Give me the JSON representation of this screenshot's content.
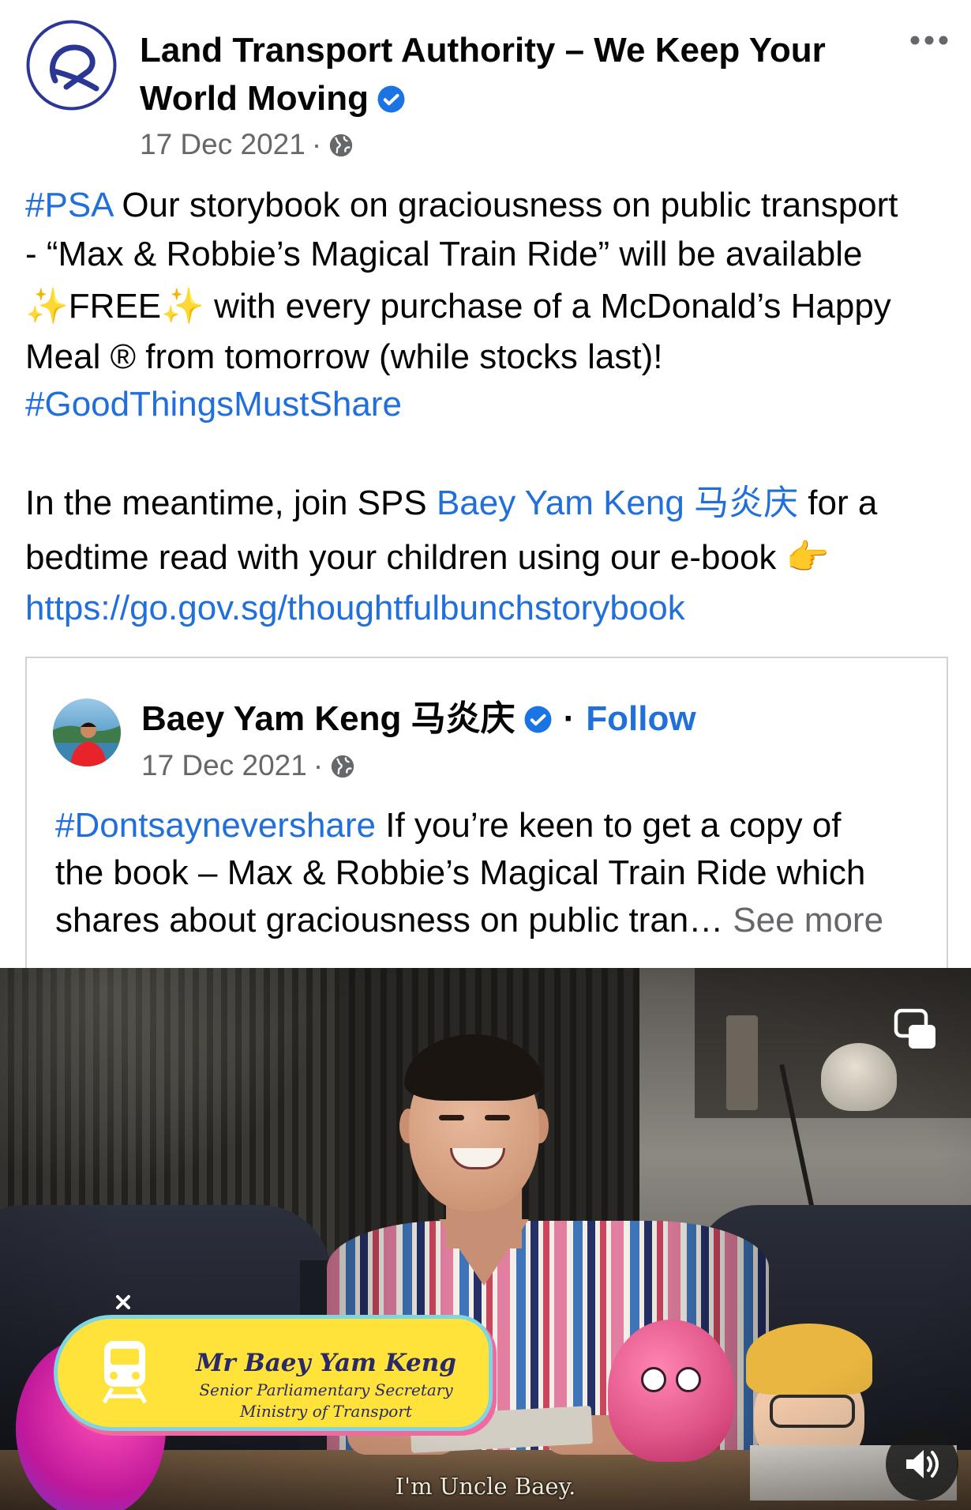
{
  "colors": {
    "text": "#050505",
    "secondary": "#65676B",
    "link": "#216FDB",
    "verified": "#1B74E4",
    "lta_navy": "#2B3795",
    "nameplate_yellow": "#FFE23A"
  },
  "post": {
    "author": "Land Transport Authority – We Keep Your World Moving",
    "verified_icon": "verified-badge-icon",
    "date": "17 Dec 2021",
    "separator": "·",
    "privacy_icon": "globe-icon",
    "more_icon": "more-options-icon",
    "body": [
      {
        "hashtag": "#PSA",
        "text": " Our storybook on graciousness on public transport"
      },
      {
        "text": "- “Max & Robbie’s Magical Train Ride” will be available"
      },
      {
        "emoji_1": "✨",
        "text": "FREE",
        "emoji_2": "✨",
        "text_after": " with every purchase of a McDonald’s Happy"
      },
      {
        "text": "Meal ® from tomorrow (while stocks last)!"
      },
      {
        "hashtag": "#GoodThingsMustShare"
      },
      {
        "text": "In the meantime, join SPS ",
        "mention": "Baey Yam Keng 马炎庆",
        "text_after": " for a"
      },
      {
        "text": "bedtime read with your children using our e-book ",
        "emoji": "👉"
      },
      {
        "link": "https://go.gov.sg/thoughtfulbunchstorybook"
      }
    ]
  },
  "shared_post": {
    "author": "Baey Yam Keng 马炎庆",
    "verified_icon": "verified-badge-icon",
    "separator": "·",
    "follow_label": "Follow",
    "date": "17 Dec 2021",
    "privacy_icon": "globe-icon",
    "body": [
      {
        "hashtag": "#Dontsaynevershare",
        "text": " If you’re keen to get a copy of"
      },
      {
        "text": "the book – Max & Robbie’s Magical Train Ride which"
      },
      {
        "text": "shares about graciousness on public tran…",
        "see_more": "See more"
      }
    ]
  },
  "video": {
    "nameplate": {
      "name": "Mr Baey Yam Keng",
      "title": "Senior Parliamentary Secretary",
      "organisation": "Ministry of Transport"
    },
    "subtitle": "I'm Uncle Baey.",
    "pip_icon": "picture-in-picture-icon",
    "volume_icon": "volume-on-icon"
  }
}
